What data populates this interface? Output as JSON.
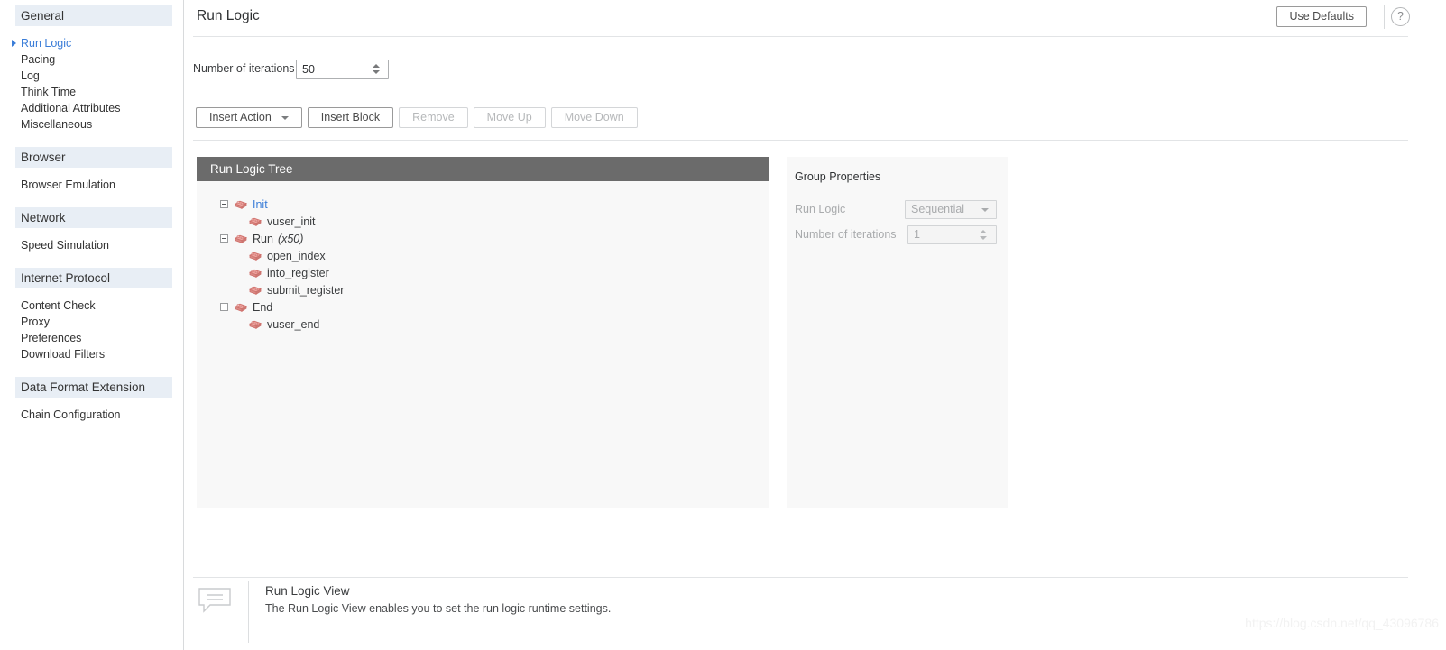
{
  "sidebar": {
    "groups": [
      {
        "header": "General",
        "items": [
          {
            "label": "Run Logic",
            "active": true
          },
          {
            "label": "Pacing",
            "active": false
          },
          {
            "label": "Log",
            "active": false
          },
          {
            "label": "Think Time",
            "active": false
          },
          {
            "label": "Additional Attributes",
            "active": false
          },
          {
            "label": "Miscellaneous",
            "active": false
          }
        ]
      },
      {
        "header": "Browser",
        "items": [
          {
            "label": "Browser Emulation",
            "active": false
          }
        ]
      },
      {
        "header": "Network",
        "items": [
          {
            "label": "Speed Simulation",
            "active": false
          }
        ]
      },
      {
        "header": "Internet Protocol",
        "items": [
          {
            "label": "Content Check",
            "active": false
          },
          {
            "label": "Proxy",
            "active": false
          },
          {
            "label": "Preferences",
            "active": false
          },
          {
            "label": "Download Filters",
            "active": false
          }
        ]
      },
      {
        "header": "Data Format Extension",
        "items": [
          {
            "label": "Chain Configuration",
            "active": false
          }
        ]
      }
    ]
  },
  "header": {
    "title": "Run Logic",
    "use_defaults_label": "Use Defaults",
    "help_icon": "help-circle-icon",
    "help_glyph": "?"
  },
  "iterations": {
    "label": "Number of iterations",
    "value": "50",
    "placeholder": "",
    "spinner_icon": "spinner-updown-icon"
  },
  "toolbar": {
    "buttons": [
      {
        "label": "Insert Action",
        "disabled": false,
        "has_caret": true
      },
      {
        "label": "Insert Block",
        "disabled": false,
        "has_caret": false
      },
      {
        "label": "Remove",
        "disabled": true,
        "has_caret": false
      },
      {
        "label": "Move Up",
        "disabled": true,
        "has_caret": false
      },
      {
        "label": "Move Down",
        "disabled": true,
        "has_caret": false
      }
    ]
  },
  "tree": {
    "header": "Run Logic Tree",
    "nodes": [
      {
        "label": "Init",
        "multiplier": "",
        "level": 0,
        "expandable": true,
        "selected": true,
        "icon": "block-brick-icon"
      },
      {
        "label": "vuser_init",
        "multiplier": "",
        "level": 1,
        "expandable": false,
        "selected": false,
        "icon": "block-brick-icon"
      },
      {
        "label": "Run",
        "multiplier": "(x50)",
        "level": 0,
        "expandable": true,
        "selected": false,
        "icon": "block-brick-icon"
      },
      {
        "label": "open_index",
        "multiplier": "",
        "level": 1,
        "expandable": false,
        "selected": false,
        "icon": "block-brick-icon"
      },
      {
        "label": "into_register",
        "multiplier": "",
        "level": 1,
        "expandable": false,
        "selected": false,
        "icon": "block-brick-icon"
      },
      {
        "label": "submit_register",
        "multiplier": "",
        "level": 1,
        "expandable": false,
        "selected": false,
        "icon": "block-brick-icon"
      },
      {
        "label": "End",
        "multiplier": "",
        "level": 0,
        "expandable": true,
        "selected": false,
        "icon": "block-brick-icon"
      },
      {
        "label": "vuser_end",
        "multiplier": "",
        "level": 1,
        "expandable": false,
        "selected": false,
        "icon": "block-brick-icon"
      }
    ]
  },
  "group_properties": {
    "title": "Group Properties",
    "run_logic_label": "Run Logic",
    "run_logic_value": "Sequential",
    "run_logic_options": [
      "Sequential"
    ],
    "iterations_label": "Number of iterations",
    "iterations_value": "1",
    "disabled": true
  },
  "footer": {
    "icon": "speech-bubble-icon",
    "title": "Run Logic View",
    "description": "The Run Logic View enables you to set the run logic runtime settings."
  },
  "watermark": {
    "text": "https://blog.csdn.net/qq_43096786"
  },
  "colors": {
    "accent_blue": "#3b7dd8",
    "section_header_bg": "#e8eef5",
    "tree_header_bg": "#6b6b6b",
    "panel_bg": "#f8f8f8",
    "brick_red": "#e08a86"
  }
}
